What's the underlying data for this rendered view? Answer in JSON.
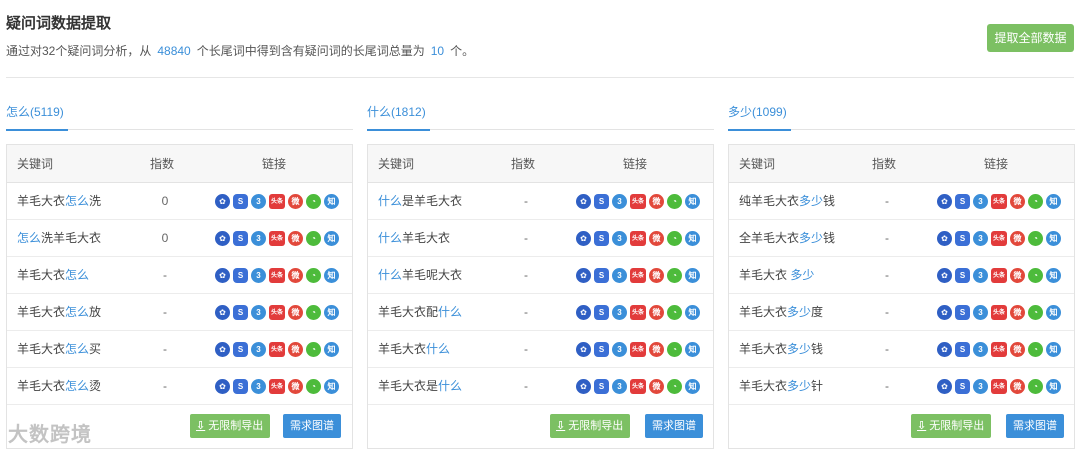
{
  "header": {
    "title": "疑问词数据提取",
    "summary_prefix": "通过对32个疑问词分析，从",
    "summary_total": "48840",
    "summary_mid": "个长尾词中得到含有疑问词的长尾词总量为",
    "summary_count": "10",
    "summary_suffix": "个。",
    "extract_all_label": "提取全部数据"
  },
  "table_headers": {
    "keyword": "关键词",
    "index": "指数",
    "links": "链接"
  },
  "link_icons": [
    "baidu-icon",
    "sogou-icon",
    "360-icon",
    "toutiao-icon",
    "weibo-icon",
    "wechat-icon",
    "zhihu-icon"
  ],
  "icon_glyphs": {
    "baidu": "✿",
    "sogou": "S",
    "p360": "3",
    "toutiao": "头条",
    "weibo": "微",
    "wechat": "◔",
    "zhihu": "知"
  },
  "buttons": {
    "export": "无限制导出",
    "graph": "需求图谱"
  },
  "watermark": "大数跨境",
  "columns": [
    {
      "tab": "怎么(5119)",
      "rows": [
        {
          "kw": [
            [
              "羊毛大衣",
              false
            ],
            [
              "怎么",
              true
            ],
            [
              "洗",
              false
            ]
          ],
          "index": "0"
        },
        {
          "kw": [
            [
              "怎么",
              true
            ],
            [
              "洗羊毛大衣",
              false
            ]
          ],
          "index": "0"
        },
        {
          "kw": [
            [
              "羊毛大衣",
              false
            ],
            [
              "怎么",
              true
            ]
          ],
          "index": "-"
        },
        {
          "kw": [
            [
              "羊毛大衣",
              false
            ],
            [
              "怎么",
              true
            ],
            [
              "放",
              false
            ]
          ],
          "index": "-"
        },
        {
          "kw": [
            [
              "羊毛大衣",
              false
            ],
            [
              "怎么",
              true
            ],
            [
              "买",
              false
            ]
          ],
          "index": "-"
        },
        {
          "kw": [
            [
              "羊毛大衣",
              false
            ],
            [
              "怎么",
              true
            ],
            [
              "烫",
              false
            ]
          ],
          "index": "-"
        }
      ]
    },
    {
      "tab": "什么(1812)",
      "rows": [
        {
          "kw": [
            [
              "什么",
              true
            ],
            [
              "是羊毛大衣",
              false
            ]
          ],
          "index": "-"
        },
        {
          "kw": [
            [
              "什么",
              true
            ],
            [
              "羊毛大衣",
              false
            ]
          ],
          "index": "-"
        },
        {
          "kw": [
            [
              "什么",
              true
            ],
            [
              "羊毛呢大衣",
              false
            ]
          ],
          "index": "-"
        },
        {
          "kw": [
            [
              "羊毛大衣配",
              false
            ],
            [
              "什么",
              true
            ]
          ],
          "index": "-"
        },
        {
          "kw": [
            [
              "羊毛大衣",
              false
            ],
            [
              "什么",
              true
            ]
          ],
          "index": "-"
        },
        {
          "kw": [
            [
              "羊毛大衣是",
              false
            ],
            [
              "什么",
              true
            ]
          ],
          "index": "-"
        }
      ]
    },
    {
      "tab": "多少(1099)",
      "rows": [
        {
          "kw": [
            [
              "纯羊毛大衣",
              false
            ],
            [
              "多少",
              true
            ],
            [
              "钱",
              false
            ]
          ],
          "index": "-"
        },
        {
          "kw": [
            [
              "全羊毛大衣",
              false
            ],
            [
              "多少",
              true
            ],
            [
              "钱",
              false
            ]
          ],
          "index": "-"
        },
        {
          "kw": [
            [
              "羊毛大衣 ",
              false
            ],
            [
              "多少",
              true
            ]
          ],
          "index": "-"
        },
        {
          "kw": [
            [
              "羊毛大衣",
              false
            ],
            [
              "多少",
              true
            ],
            [
              "度",
              false
            ]
          ],
          "index": "-"
        },
        {
          "kw": [
            [
              "羊毛大衣",
              false
            ],
            [
              "多少",
              true
            ],
            [
              "钱",
              false
            ]
          ],
          "index": "-"
        },
        {
          "kw": [
            [
              "羊毛大衣",
              false
            ],
            [
              "多少",
              true
            ],
            [
              "针",
              false
            ]
          ],
          "index": "-"
        }
      ]
    }
  ]
}
